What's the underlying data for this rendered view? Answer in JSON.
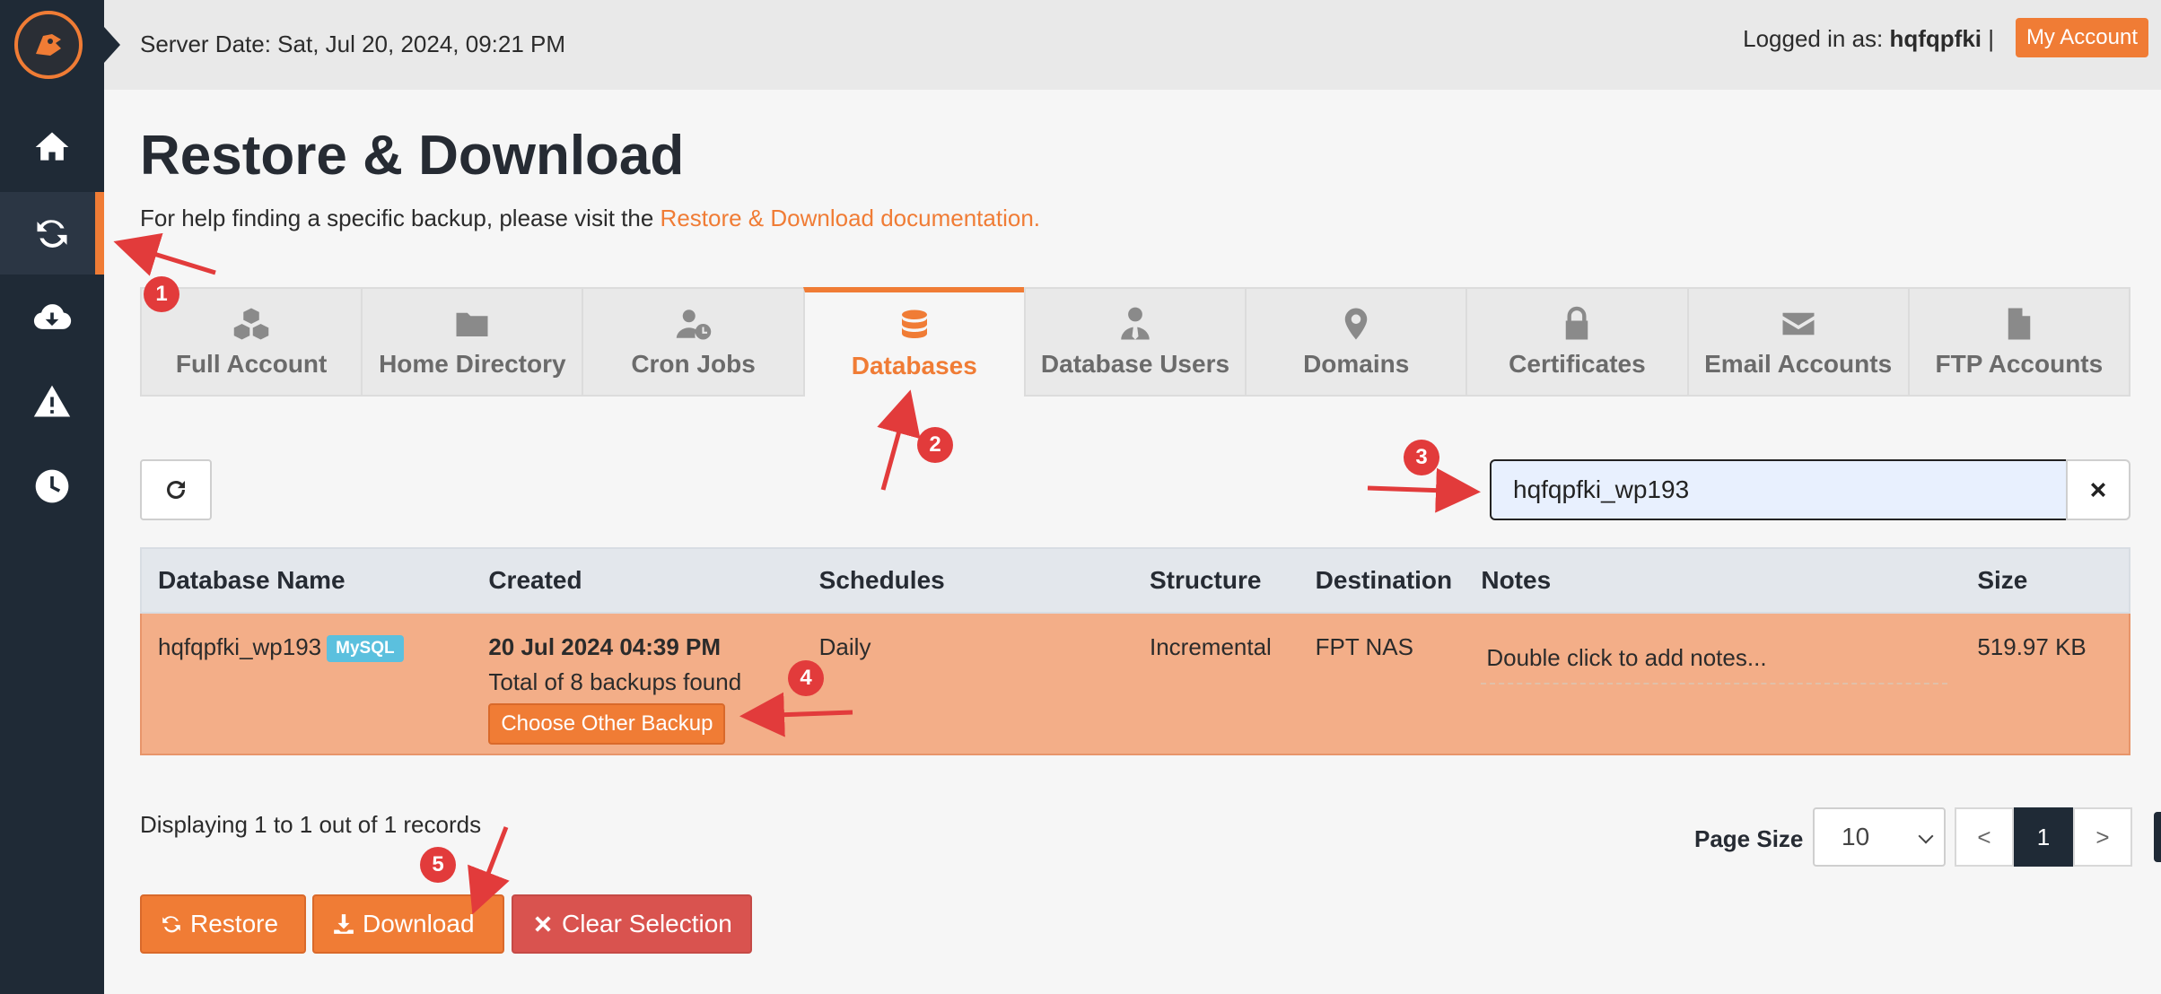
{
  "header": {
    "server_date": "Server Date: Sat, Jul 20, 2024, 09:21 PM",
    "logged_in_prefix": "Logged in as: ",
    "username": "hqfqpfki",
    "separator": " |",
    "my_account": "My Account"
  },
  "sidebar": {
    "items": [
      {
        "icon": "home-icon",
        "active": false
      },
      {
        "icon": "sync-icon",
        "active": true
      },
      {
        "icon": "cloud-download-icon",
        "active": false
      },
      {
        "icon": "warning-icon",
        "active": false
      },
      {
        "icon": "clock-icon",
        "active": false
      }
    ]
  },
  "page": {
    "title": "Restore & Download",
    "help_text": "For help finding a specific backup, please visit the ",
    "help_link": "Restore & Download documentation."
  },
  "tabs": [
    {
      "label": "Full Account",
      "icon": "cubes-icon"
    },
    {
      "label": "Home Directory",
      "icon": "folder-icon"
    },
    {
      "label": "Cron Jobs",
      "icon": "user-clock-icon"
    },
    {
      "label": "Databases",
      "icon": "database-icon",
      "active": true
    },
    {
      "label": "Database Users",
      "icon": "user-tie-icon"
    },
    {
      "label": "Domains",
      "icon": "map-marker-icon"
    },
    {
      "label": "Certificates",
      "icon": "lock-icon"
    },
    {
      "label": "Email Accounts",
      "icon": "envelope-icon"
    },
    {
      "label": "FTP Accounts",
      "icon": "file-icon"
    }
  ],
  "search": {
    "value": "hqfqpfki_wp193"
  },
  "table": {
    "headers": [
      "Database Name",
      "Created",
      "Schedules",
      "Structure",
      "Destination",
      "Notes",
      "Size"
    ],
    "rows": [
      {
        "name": "hqfqpfki_wp193",
        "badge": "MySQL",
        "created_date": "20 Jul 2024 04:39 PM",
        "created_total": "Total of 8 backups found",
        "choose_button": "Choose Other Backup",
        "schedule": "Daily",
        "structure": "Incremental",
        "destination": "FPT NAS",
        "notes_placeholder": "Double click to add notes...",
        "size": "519.97 KB"
      }
    ]
  },
  "footer": {
    "displaying": "Displaying 1 to 1 out of 1 records",
    "page_size_label": "Page Size",
    "page_size_value": "10",
    "pager": [
      "<",
      "1",
      ">"
    ],
    "restore": "Restore",
    "download": "Download",
    "clear_selection": "Clear Selection"
  },
  "annotations": {
    "markers": [
      "1",
      "2",
      "3",
      "4",
      "5"
    ],
    "color": "#e23b3b"
  },
  "colors": {
    "accent": "#f07c35",
    "sidebar": "#1f2a36",
    "selected_row": "#f3ae88",
    "danger": "#d9534f",
    "badge": "#5bc0de"
  }
}
